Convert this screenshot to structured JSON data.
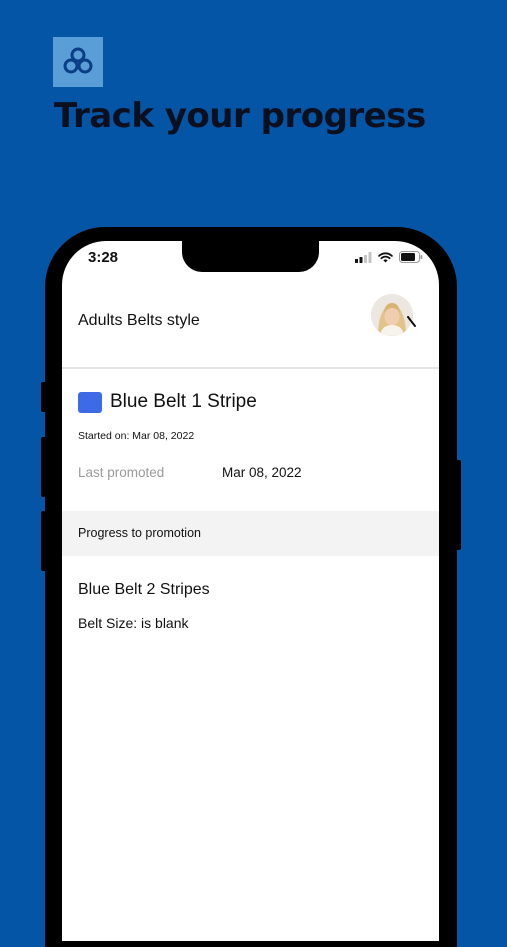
{
  "promo": {
    "headline": "Track your progress",
    "logo_icon": "triple-loop-logo-icon",
    "background_color": "#0455a6"
  },
  "status_bar": {
    "time": "3:28",
    "icons": [
      "cellular-signal-icon",
      "wifi-icon",
      "battery-icon"
    ]
  },
  "header": {
    "title": "Adults Belts style",
    "avatar_icon": "profile-avatar"
  },
  "current_belt": {
    "name": "Blue Belt 1 Stripe",
    "color": "#3d6ae6",
    "started_on": "Started on: Mar 08, 2022",
    "last_promoted_label": "Last promoted",
    "last_promoted_value": "Mar 08, 2022"
  },
  "progress": {
    "label": "Progress to promotion"
  },
  "next_belt": {
    "name": "Blue Belt 2 Stripes",
    "belt_size": "Belt Size: is blank"
  }
}
